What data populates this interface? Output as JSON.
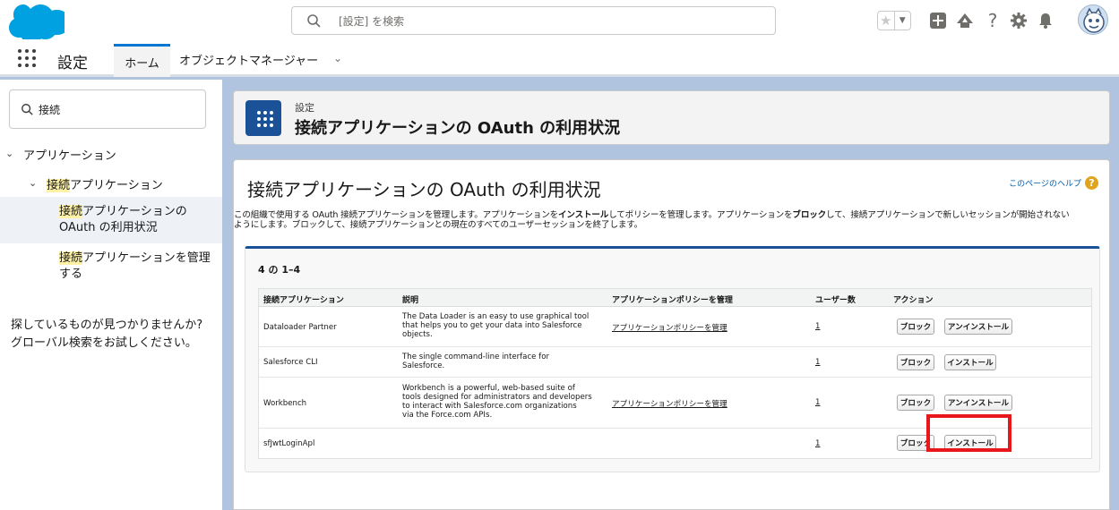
{
  "header": {
    "search_placeholder": "[設定] を検索"
  },
  "nav": {
    "app_name": "設定",
    "tabs": [
      {
        "label": "ホーム"
      },
      {
        "label": "オブジェクトマネージャー"
      }
    ]
  },
  "sidebar": {
    "quick_find_value": "接続",
    "tree": {
      "section": "アプリケーション",
      "group_hl": "接続",
      "group_rest": "アプリケーション",
      "item1_hl": "接続",
      "item1_rest_line1": "アプリケーションの",
      "item1_rest_line2": "OAuth の利用状況",
      "item2_hl": "接続",
      "item2_rest_line1": "アプリケーションを管理",
      "item2_rest_line2": "する"
    },
    "not_found_line1": "探しているものが見つかりませんか?",
    "not_found_line2": "グローバル検索をお試しください。"
  },
  "page_header": {
    "breadcrumb": "設定",
    "title": "接続アプリケーションの OAuth の利用状況"
  },
  "content": {
    "heading": "接続アプリケーションの OAuth の利用状況",
    "help_link": "このページのヘルプ",
    "desc_a": "この組織で使用する OAuth 接続アプリケーションを管理します。アプリケーションを",
    "desc_b": "インストール",
    "desc_c": "してポリシーを管理します。アプリケーションを",
    "desc_d": "ブロック",
    "desc_e": "して、接続アプリケーションで新しいセッションが開始されない",
    "desc_line2": "ようにします。ブロックして、接続アプリケーションとの現在のすべてのユーザーセッションを終了します。",
    "count": "4 の 1–4",
    "columns": [
      "接続アプリケーション",
      "説明",
      "アプリケーションポリシーを管理",
      "ユーザー数",
      "アクション"
    ],
    "rows": [
      {
        "name": "Dataloader Partner",
        "desc1": "The Data Loader is an easy to use graphical tool",
        "desc2": "that helps you to get your data into Salesforce",
        "desc3": "objects.",
        "policy": "アプリケーションポリシーを管理",
        "users": "1",
        "block": "ブロック",
        "action": "アンインストール"
      },
      {
        "name": "Salesforce CLI",
        "desc1": "The single command-line interface for",
        "desc2": "Salesforce.",
        "policy": "",
        "users": "1",
        "block": "ブロック",
        "action": "インストール"
      },
      {
        "name": "Workbench",
        "desc1": "Workbench is a powerful, web-based suite of",
        "desc2": "tools designed for administrators and developers",
        "desc3": "to interact with Salesforce.com organizations",
        "desc4": "via the Force.com APIs.",
        "policy": "アプリケーションポリシーを管理",
        "users": "1",
        "block": "ブロック",
        "action": "アンインストール"
      },
      {
        "name": "sfJwtLoginApl",
        "policy": "",
        "users": "1",
        "block": "ブロック",
        "action": "インストール"
      }
    ]
  },
  "colors": {
    "accent_blue": "#0176d3",
    "highlight_red": "#e8171b",
    "page_header_icon": "#1b5297"
  }
}
